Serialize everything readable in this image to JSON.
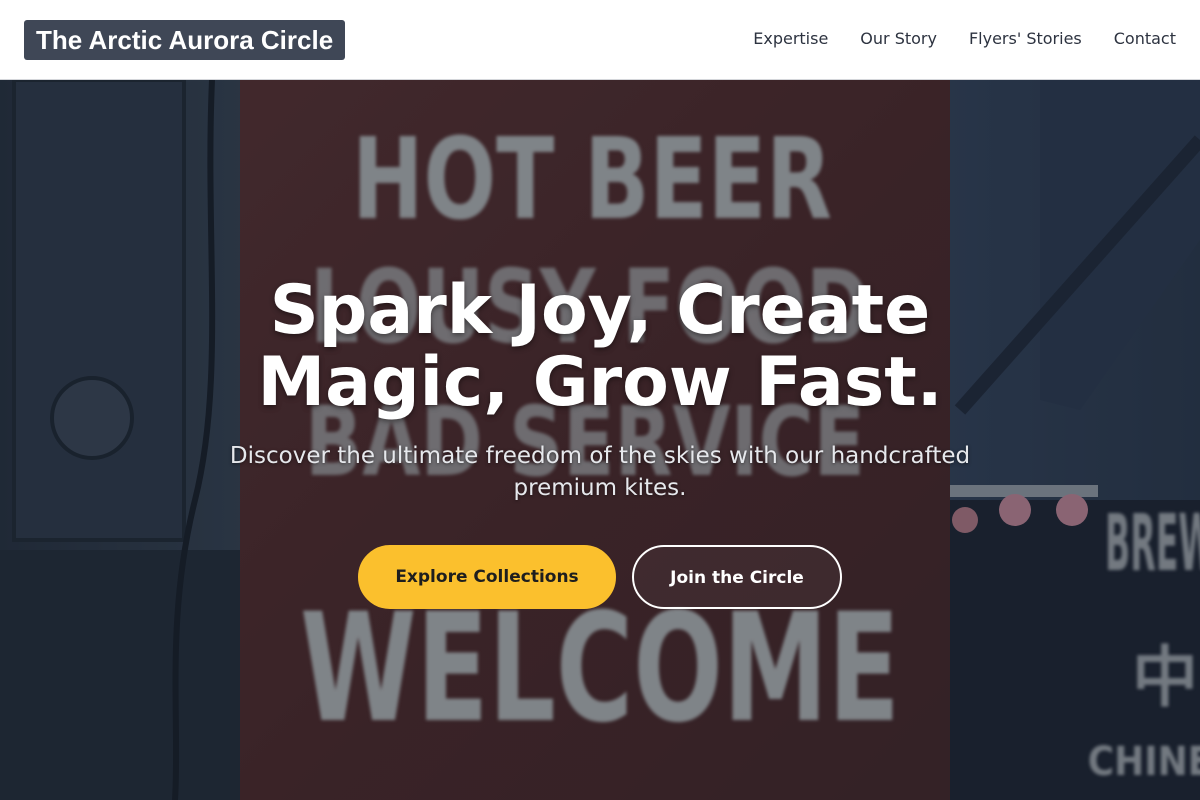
{
  "brand": {
    "name": "The Arctic Aurora Circle"
  },
  "nav": {
    "items": [
      {
        "label": "Expertise"
      },
      {
        "label": "Our Story"
      },
      {
        "label": "Flyers' Stories"
      },
      {
        "label": "Contact"
      }
    ]
  },
  "hero": {
    "headline": "Spark Joy, Create Magic, Grow Fast.",
    "subheadline": "Discover the ultimate freedom of the skies with our handcrafted premium kites.",
    "primary_cta": "Explore Collections",
    "secondary_cta": "Join the Circle",
    "background_sign": {
      "lines": [
        "HOT BEER",
        "LOUSY FOOD",
        "BAD SERVICE",
        "WELCOME"
      ],
      "side_sign": [
        "BREW",
        "中",
        "CHINE"
      ]
    }
  },
  "colors": {
    "brand_bg": "#3f4756",
    "primary_button": "#fbc02d",
    "header_bg": "#ffffff",
    "nav_text": "#2d3340"
  }
}
